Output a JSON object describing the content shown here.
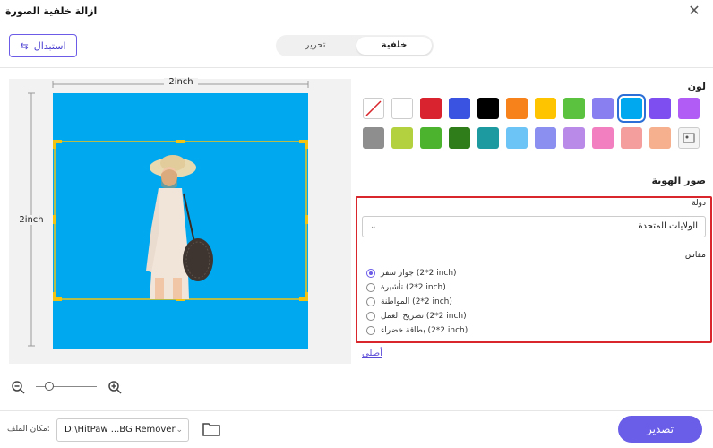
{
  "window": {
    "title": "ازالة خلفية الصورة",
    "close_icon": "close-icon"
  },
  "toolbar": {
    "swap_label": "استبدال"
  },
  "tabs": [
    {
      "label": "تحرير",
      "active": false
    },
    {
      "label": "خلفية",
      "active": true
    }
  ],
  "canvas": {
    "width_label": "2inch",
    "height_label": "2inch",
    "background_color": "#00a8f0"
  },
  "colors": {
    "label": "لون",
    "row1": [
      "none",
      "#ffffff",
      "#d9232e",
      "#3a53e0",
      "#000000",
      "#f7821b",
      "#ffc400",
      "#5bc23f",
      "#8a7ff0",
      "#00a8f0",
      "#7e4ef0",
      "#b05cf5"
    ],
    "row2": [
      "#8e8e8e",
      "#b3d03f",
      "#4cb32f",
      "#2f7d1a",
      "#1d9aa0",
      "#6cc3f5",
      "#8a8ff0",
      "#b98ae8",
      "#f27fc0",
      "#f59e9e",
      "#f6b08e",
      "custom"
    ],
    "selected_index": 9
  },
  "id_photos": {
    "label": "صور الهوية",
    "country_label": "دولة",
    "country_value": "الولايات المتحدة",
    "size_label": "مقاس",
    "options": [
      {
        "label": "جواز سفر (2*2 inch)",
        "checked": true
      },
      {
        "label": "تأشيرة (2*2 inch)",
        "checked": false
      },
      {
        "label": "المواطنة (2*2 inch)",
        "checked": false
      },
      {
        "label": "تصريح العمل (2*2 inch)",
        "checked": false
      },
      {
        "label": "بطاقة خضراء (2*2 inch)",
        "checked": false
      }
    ],
    "original_link": "أصلي"
  },
  "footer": {
    "location_label": "مكان الملف:",
    "path_value": "D:\\HitPaw ...BG Remover",
    "export_label": "تصدير"
  }
}
